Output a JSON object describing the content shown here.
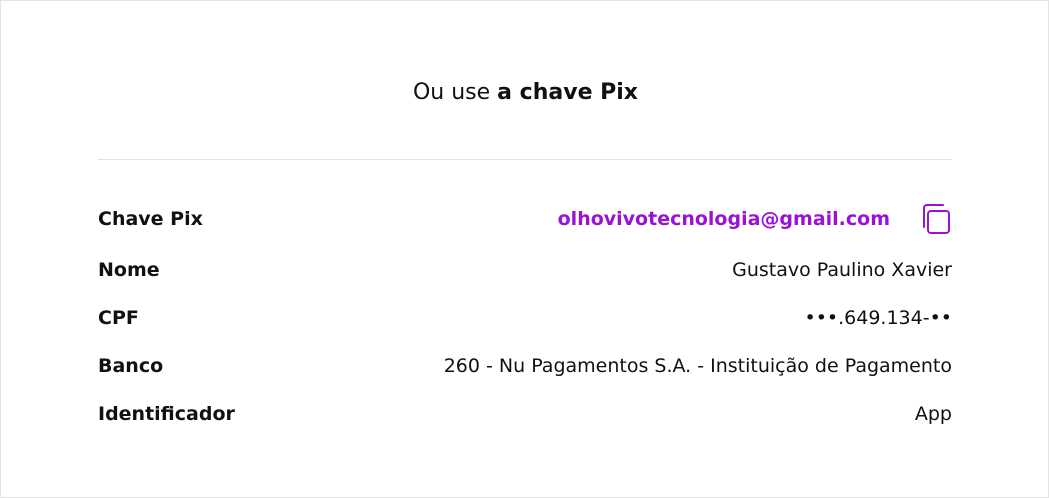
{
  "heading": {
    "prefix": "Ou use",
    "emphasis": "a chave Pix"
  },
  "details": {
    "pix_key": {
      "label": "Chave Pix",
      "value": "olhovivotecnologia@gmail.com"
    },
    "name": {
      "label": "Nome",
      "value": "Gustavo Paulino Xavier"
    },
    "cpf": {
      "label": "CPF",
      "value": "•••.649.134-••"
    },
    "bank": {
      "label": "Banco",
      "value": "260 - Nu Pagamentos S.A. - Instituição de Pagamento"
    },
    "identifier": {
      "label": "Identificador",
      "value": "App"
    }
  },
  "icons": {
    "copy": "copy-icon"
  },
  "colors": {
    "accent": "#9b12d4",
    "text": "#111111",
    "divider": "#e2e2e2"
  }
}
